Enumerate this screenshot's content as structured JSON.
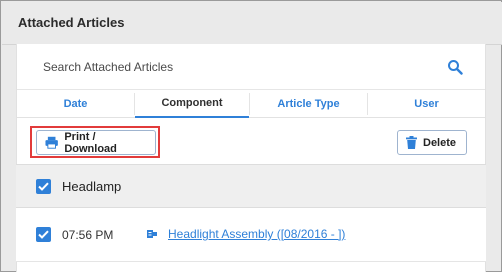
{
  "header": {
    "title": "Attached Articles"
  },
  "search": {
    "placeholder": "Search Attached Articles",
    "value": ""
  },
  "tabs": [
    {
      "label": "Date",
      "active": false
    },
    {
      "label": "Component",
      "active": true
    },
    {
      "label": "Article Type",
      "active": false
    },
    {
      "label": "User",
      "active": false
    }
  ],
  "toolbar": {
    "print_label": "Print / Download",
    "delete_label": "Delete"
  },
  "group": {
    "label": "Headlamp",
    "checked": true
  },
  "item": {
    "time": "07:56 PM",
    "title": "Headlight Assembly ([08/2016 - ])",
    "checked": true
  },
  "colors": {
    "accent": "#2f80d8",
    "highlight": "#e23b3b"
  }
}
